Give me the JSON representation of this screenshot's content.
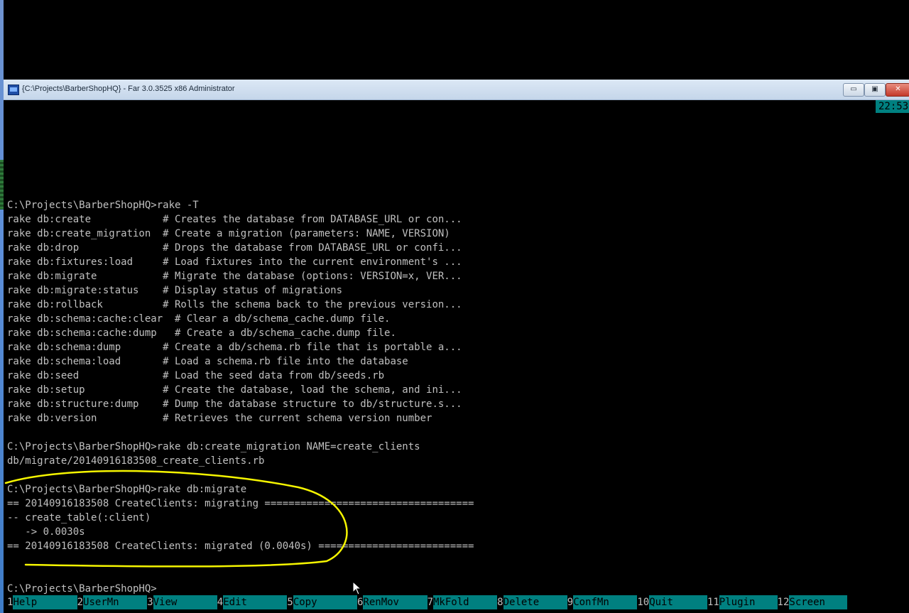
{
  "window": {
    "title": "{C:\\Projects\\BarberShopHQ} - Far 3.0.3525 x86 Administrator",
    "clock": "22:53",
    "min_glyph": "▭",
    "max_glyph": "▣",
    "close_glyph": "✕"
  },
  "console": {
    "lines": [
      "C:\\Projects\\BarberShopHQ>rake -T",
      "rake db:create            # Creates the database from DATABASE_URL or con...",
      "rake db:create_migration  # Create a migration (parameters: NAME, VERSION)",
      "rake db:drop              # Drops the database from DATABASE_URL or confi...",
      "rake db:fixtures:load     # Load fixtures into the current environment's ...",
      "rake db:migrate           # Migrate the database (options: VERSION=x, VER...",
      "rake db:migrate:status    # Display status of migrations",
      "rake db:rollback          # Rolls the schema back to the previous version...",
      "rake db:schema:cache:clear  # Clear a db/schema_cache.dump file.",
      "rake db:schema:cache:dump   # Create a db/schema_cache.dump file.",
      "rake db:schema:dump       # Create a db/schema.rb file that is portable a...",
      "rake db:schema:load       # Load a schema.rb file into the database",
      "rake db:seed              # Load the seed data from db/seeds.rb",
      "rake db:setup             # Create the database, load the schema, and ini...",
      "rake db:structure:dump    # Dump the database structure to db/structure.s...",
      "rake db:version           # Retrieves the current schema version number",
      "",
      "C:\\Projects\\BarberShopHQ>rake db:create_migration NAME=create_clients",
      "db/migrate/20140916183508_create_clients.rb",
      "",
      "C:\\Projects\\BarberShopHQ>rake db:migrate",
      "== 20140916183508 CreateClients: migrating ===================================",
      "-- create_table(:client)",
      "   -> 0.0030s",
      "== 20140916183508 CreateClients: migrated (0.0040s) ==========================",
      "",
      "",
      "C:\\Projects\\BarberShopHQ>"
    ]
  },
  "keybar": [
    {
      "num": "1",
      "label": "Help"
    },
    {
      "num": "2",
      "label": "UserMn"
    },
    {
      "num": "3",
      "label": "View"
    },
    {
      "num": "4",
      "label": "Edit"
    },
    {
      "num": "5",
      "label": "Copy"
    },
    {
      "num": "6",
      "label": "RenMov"
    },
    {
      "num": "7",
      "label": "MkFold"
    },
    {
      "num": "8",
      "label": "Delete"
    },
    {
      "num": "9",
      "label": "ConfMn"
    },
    {
      "num": "10",
      "label": "Quit"
    },
    {
      "num": "11",
      "label": "Plugin"
    },
    {
      "num": "12",
      "label": "Screen"
    }
  ],
  "colors": {
    "panel_teal": "#008080",
    "annotation_yellow": "#f5f500",
    "console_text": "#c0c0c0"
  }
}
